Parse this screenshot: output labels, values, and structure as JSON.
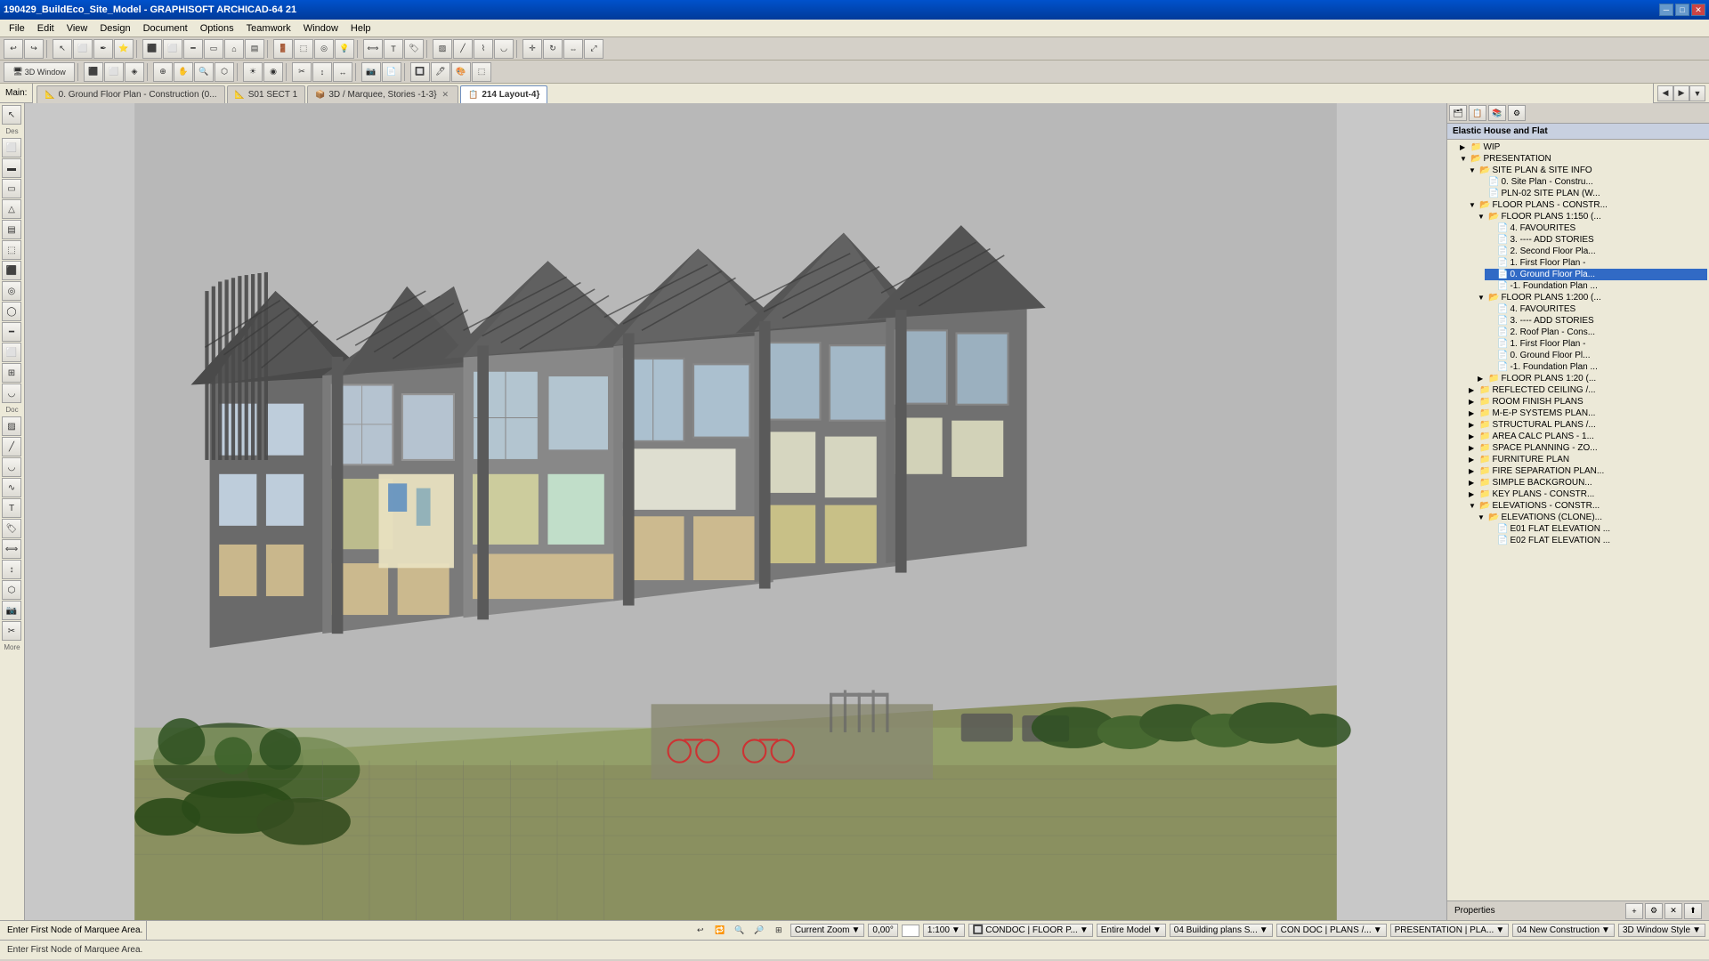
{
  "title_bar": {
    "title": "190429_BuildEco_Site_Model - GRAPHISOFT ARCHICAD-64 21",
    "win_min": "─",
    "win_max": "□",
    "win_close": "✕"
  },
  "menu": {
    "items": [
      "File",
      "Edit",
      "View",
      "Design",
      "Document",
      "Options",
      "Teamwork",
      "Window",
      "Help"
    ]
  },
  "toolbar1": {
    "label": "",
    "buttons": [
      "↩",
      "↪",
      "⬅",
      "→",
      "✏",
      "◯",
      "⬜",
      "⬟",
      "▷",
      "⬡",
      "🔧",
      "✂",
      "⊕",
      "⊗"
    ]
  },
  "toolbar2": {
    "mode_label": "3D Window",
    "buttons": [
      "⬛",
      "⬜",
      "◈",
      "⊕",
      "⬡",
      "▲",
      "◉",
      "⊞",
      "⊟",
      "⊠",
      "⊡",
      "◫",
      "⬚",
      "◱"
    ]
  },
  "main_label": "Main:",
  "tabs": [
    {
      "id": "tab1",
      "icon": "📐",
      "label": "0. Ground Floor Plan - Construction (0...)",
      "closable": false,
      "active": false
    },
    {
      "id": "tab2",
      "icon": "📐",
      "label": "S01 SECT 1",
      "closable": false,
      "active": false
    },
    {
      "id": "tab3",
      "icon": "📦",
      "label": "3D / Marquee, Stories -1-3}",
      "closable": true,
      "active": false
    },
    {
      "id": "tab4",
      "icon": "📋",
      "label": "214 Layout-4}",
      "closable": false,
      "active": true
    }
  ],
  "project_tree": {
    "root_label": "Elastic House and Flat",
    "sections": [
      {
        "id": "wip",
        "label": "WIP",
        "level": 1,
        "type": "folder",
        "expanded": false
      },
      {
        "id": "presentation",
        "label": "PRESENTATION",
        "level": 1,
        "type": "folder",
        "expanded": true
      },
      {
        "id": "site_plan_info",
        "label": "SITE PLAN & SITE INFO",
        "level": 2,
        "type": "folder",
        "expanded": true
      },
      {
        "id": "site_plan_constr",
        "label": "0. Site Plan - Constru...",
        "level": 3,
        "type": "file"
      },
      {
        "id": "pln02_site_plan",
        "label": "PLN-02 SITE PLAN (W...",
        "level": 3,
        "type": "file"
      },
      {
        "id": "floor_plans_constr",
        "label": "FLOOR PLANS - CONSTR...",
        "level": 2,
        "type": "folder",
        "expanded": true
      },
      {
        "id": "floor_plans_1150",
        "label": "FLOOR PLANS 1:150 (...",
        "level": 3,
        "type": "folder",
        "expanded": true
      },
      {
        "id": "favourites_a",
        "label": "4. FAVOURITES",
        "level": 4,
        "type": "file"
      },
      {
        "id": "add_stories_a",
        "label": "3. ---- ADD STORIES",
        "level": 4,
        "type": "file"
      },
      {
        "id": "second_floor_a",
        "label": "2. Second Floor Pla...",
        "level": 4,
        "type": "file"
      },
      {
        "id": "first_floor_a",
        "label": "1. First Floor Plan -",
        "level": 4,
        "type": "file"
      },
      {
        "id": "ground_floor_a",
        "label": "0. Ground Floor Pla...",
        "level": 4,
        "type": "file",
        "selected": true
      },
      {
        "id": "foundation_a",
        "label": "-1. Foundation Plan ...",
        "level": 4,
        "type": "file"
      },
      {
        "id": "floor_plans_1200",
        "label": "FLOOR PLANS 1:200 (...",
        "level": 3,
        "type": "folder",
        "expanded": true
      },
      {
        "id": "favourites_b",
        "label": "4. FAVOURITES",
        "level": 4,
        "type": "file"
      },
      {
        "id": "add_stories_b",
        "label": "3. ---- ADD STORIES",
        "level": 4,
        "type": "file"
      },
      {
        "id": "roof_plan_cons",
        "label": "2. Roof Plan - Cons...",
        "level": 4,
        "type": "file"
      },
      {
        "id": "first_floor_b",
        "label": "1. First Floor Plan -",
        "level": 4,
        "type": "file"
      },
      {
        "id": "ground_floor_b",
        "label": "0. Ground Floor Pl...",
        "level": 4,
        "type": "file"
      },
      {
        "id": "foundation_b",
        "label": "-1. Foundation Plan ...",
        "level": 4,
        "type": "file"
      },
      {
        "id": "floor_plans_120",
        "label": "FLOOR PLANS 1:20 (...",
        "level": 3,
        "type": "folder",
        "expanded": false
      },
      {
        "id": "reflected_ceiling",
        "label": "REFLECTED CEILING /...",
        "level": 2,
        "type": "folder",
        "expanded": false
      },
      {
        "id": "room_finish_plans",
        "label": "ROOM FINISH PLANS",
        "level": 2,
        "type": "folder",
        "expanded": false
      },
      {
        "id": "mep_systems",
        "label": "M-E-P SYSTEMS PLAN...",
        "level": 2,
        "type": "folder",
        "expanded": false
      },
      {
        "id": "structural_plans",
        "label": "STRUCTURAL PLANS /...",
        "level": 2,
        "type": "folder",
        "expanded": false
      },
      {
        "id": "area_calc_plans",
        "label": "AREA CALC PLANS - 1...",
        "level": 2,
        "type": "folder",
        "expanded": false
      },
      {
        "id": "space_planning",
        "label": "SPACE PLANNING - ZO...",
        "level": 2,
        "type": "folder",
        "expanded": false
      },
      {
        "id": "furniture_plan",
        "label": "FURNITURE PLAN",
        "level": 2,
        "type": "folder",
        "expanded": false
      },
      {
        "id": "fire_separation",
        "label": "FIRE SEPARATION PLAN...",
        "level": 2,
        "type": "folder",
        "expanded": false
      },
      {
        "id": "simple_background",
        "label": "SIMPLE BACKGROUN...",
        "level": 2,
        "type": "folder",
        "expanded": false
      },
      {
        "id": "key_plans",
        "label": "KEY PLANS - CONSTR...",
        "level": 2,
        "type": "folder",
        "expanded": false
      },
      {
        "id": "elevations_constr",
        "label": "ELEVATIONS - CONSTR...",
        "level": 2,
        "type": "folder",
        "expanded": true
      },
      {
        "id": "elevations_clone",
        "label": "ELEVATIONS (CLONE)...",
        "level": 3,
        "type": "folder",
        "expanded": true
      },
      {
        "id": "e01_flat",
        "label": "E01 FLAT ELEVATION ...",
        "level": 4,
        "type": "file"
      },
      {
        "id": "e02_flat",
        "label": "E02 FLAT ELEVATION ...",
        "level": 4,
        "type": "file"
      }
    ]
  },
  "status_bar": {
    "message": "Enter First Node of Marquee Area.",
    "zoom_label": "Current Zoom",
    "zoom_value": "0,00°",
    "scale": "1:100",
    "layer": "CONDOC | FLOOR P...",
    "model": "Entire Model",
    "building_plans": "04 Building plans S...",
    "con_doc": "CON DOC | PLANS /...",
    "presentation": "PRESENTATION | PLA...",
    "new_construction": "04 New Construction",
    "window_style": "3D Window Style"
  },
  "properties_label": "Properties",
  "icons": {
    "folder_open": "▼",
    "folder_closed": "▶",
    "file": "📄",
    "arrow_right": "▶",
    "arrow_down": "▼"
  }
}
